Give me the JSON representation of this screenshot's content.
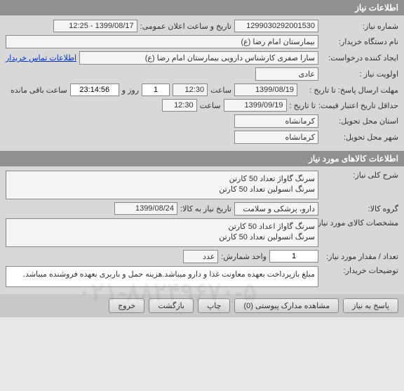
{
  "sections": {
    "need_info": "اطلاعات نیاز",
    "goods_info": "اطلاعات کالاهای مورد نیاز"
  },
  "labels": {
    "need_no": "شماره نیاز:",
    "announce_dt": "تاریخ و ساعت اعلان عمومی:",
    "buyer_org": "نام دستگاه خریدار:",
    "creator": "ایجاد کننده درخواست:",
    "priority": "اولویت نیاز :",
    "deadline_from": "مهلت ارسال پاسخ:  تا تاریخ :",
    "time1": "ساعت",
    "days": "روز و",
    "remaining": "ساعت باقی مانده",
    "min_validity": "حداقل تاریخ اعتبار قیمت:",
    "until": "تا تاریخ :",
    "time2": "ساعت",
    "delivery_province": "استان محل تحویل:",
    "delivery_city": "شهر محل تحویل:",
    "contact_link": "اطلاعات تماس خریدار",
    "general_desc": "شرح کلی نیاز:",
    "goods_group": "گروه کالا:",
    "need_date_to": "تاریخ نیاز به کالا:",
    "goods_spec": "مشخصات کالای مورد نیاز:",
    "qty": "تعداد / مقدار مورد نیاز:",
    "unit": "واحد شمارش:",
    "buyer_notes": "توضیحات خریدار:"
  },
  "values": {
    "need_no": "1299030292001530",
    "announce_dt": "1399/08/17 - 12:25",
    "buyer_org": "بیمارستان امام رضا (ع)",
    "creator": "سارا صفری کارشناس دارویی بیمارستان امام رضا (ع)",
    "priority": "عادی",
    "deadline_date": "1399/08/19",
    "deadline_time": "12:30",
    "days_left": "1",
    "time_left": "23:14:56",
    "validity_date": "1399/09/19",
    "validity_time": "12:30",
    "province": "کرمانشاه",
    "city": "کرمانشاه",
    "general_desc_line1": "سرنگ گاواژ تعداد 50 کارتن",
    "general_desc_line2": "سرنگ انسولین تعداد 50 کارتن",
    "goods_group": "دارو، پزشکی و سلامت",
    "need_date_to": "1399/08/24",
    "goods_spec_line1": "سرنگ گاواژ اعداد 50 کارتن",
    "goods_spec_line2": "سرنگ انسولین تعداد 50 کارتن",
    "qty": "1",
    "unit": "عدد",
    "buyer_notes": "مبلغ بازپرداخت بعهده معاونت غذا و دارو میباشد.هزینه حمل و باربری بعهده فروشنده میباشد."
  },
  "buttons": {
    "respond": "پاسخ به نیاز",
    "attachments": "مشاهده مدارک پیوستی  (0)",
    "print": "چاپ",
    "back": "بازگشت",
    "exit": "خروج"
  },
  "watermark": "۰۲۱-۸۸۲۴۹۶۷۰-۵"
}
